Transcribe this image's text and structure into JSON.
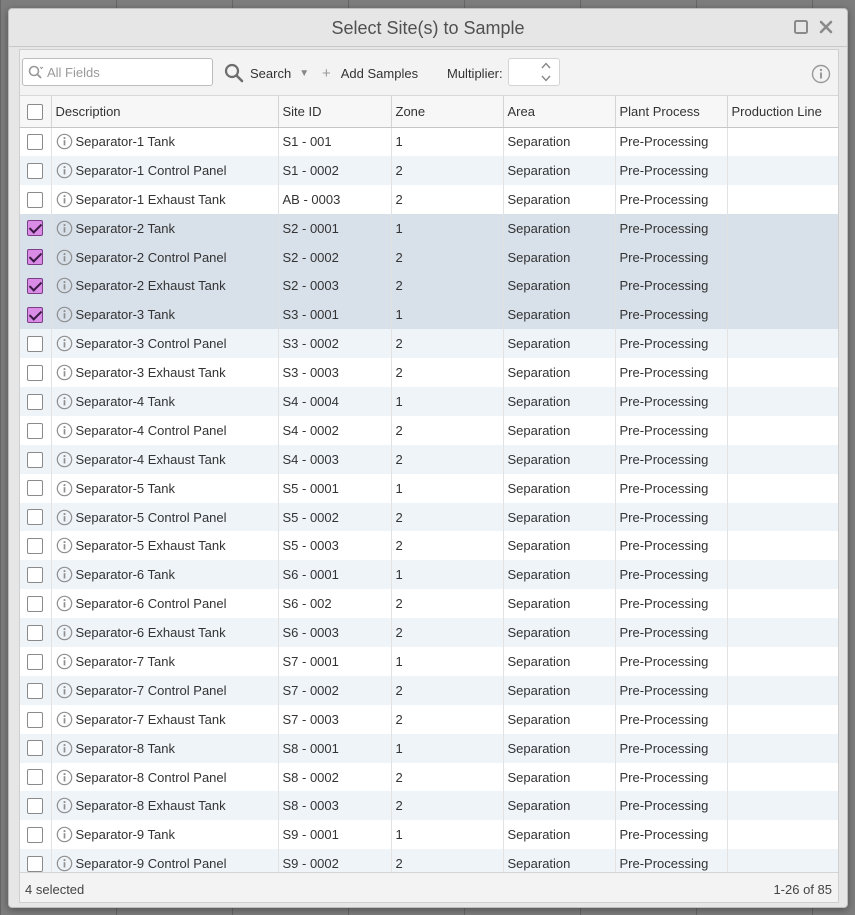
{
  "dialog": {
    "title": "Select Site(s) to Sample"
  },
  "toolbar": {
    "search_placeholder": "All Fields",
    "search_value": "",
    "search_label": "Search",
    "add_label": "Add Samples",
    "multiplier_label": "Multiplier:",
    "multiplier_value": ""
  },
  "table": {
    "columns": [
      "Description",
      "Site ID",
      "Zone",
      "Area",
      "Plant Process",
      "Production Line"
    ],
    "rows": [
      {
        "checked": false,
        "description": "Separator-1 Tank",
        "site_id": "S1 - 001",
        "zone": "1",
        "area": "Separation",
        "process": "Pre-Processing",
        "line": ""
      },
      {
        "checked": false,
        "description": "Separator-1 Control Panel",
        "site_id": "S1 - 0002",
        "zone": "2",
        "area": "Separation",
        "process": "Pre-Processing",
        "line": ""
      },
      {
        "checked": false,
        "description": "Separator-1 Exhaust Tank",
        "site_id": "AB - 0003",
        "zone": "2",
        "area": "Separation",
        "process": "Pre-Processing",
        "line": ""
      },
      {
        "checked": true,
        "description": "Separator-2 Tank",
        "site_id": "S2 - 0001",
        "zone": "1",
        "area": "Separation",
        "process": "Pre-Processing",
        "line": ""
      },
      {
        "checked": true,
        "description": "Separator-2 Control Panel",
        "site_id": "S2 - 0002",
        "zone": "2",
        "area": "Separation",
        "process": "Pre-Processing",
        "line": ""
      },
      {
        "checked": true,
        "description": "Separator-2 Exhaust Tank",
        "site_id": "S2 - 0003",
        "zone": "2",
        "area": "Separation",
        "process": "Pre-Processing",
        "line": ""
      },
      {
        "checked": true,
        "description": "Separator-3 Tank",
        "site_id": "S3 - 0001",
        "zone": "1",
        "area": "Separation",
        "process": "Pre-Processing",
        "line": ""
      },
      {
        "checked": false,
        "description": "Separator-3 Control Panel",
        "site_id": "S3 - 0002",
        "zone": "2",
        "area": "Separation",
        "process": "Pre-Processing",
        "line": ""
      },
      {
        "checked": false,
        "description": "Separator-3 Exhaust Tank",
        "site_id": "S3 - 0003",
        "zone": "2",
        "area": "Separation",
        "process": "Pre-Processing",
        "line": ""
      },
      {
        "checked": false,
        "description": "Separator-4 Tank",
        "site_id": "S4 - 0004",
        "zone": "1",
        "area": "Separation",
        "process": "Pre-Processing",
        "line": ""
      },
      {
        "checked": false,
        "description": "Separator-4 Control Panel",
        "site_id": "S4 - 0002",
        "zone": "2",
        "area": "Separation",
        "process": "Pre-Processing",
        "line": ""
      },
      {
        "checked": false,
        "description": "Separator-4 Exhaust Tank",
        "site_id": "S4 - 0003",
        "zone": "2",
        "area": "Separation",
        "process": "Pre-Processing",
        "line": ""
      },
      {
        "checked": false,
        "description": "Separator-5 Tank",
        "site_id": "S5 - 0001",
        "zone": "1",
        "area": "Separation",
        "process": "Pre-Processing",
        "line": ""
      },
      {
        "checked": false,
        "description": "Separator-5 Control Panel",
        "site_id": "S5 - 0002",
        "zone": "2",
        "area": "Separation",
        "process": "Pre-Processing",
        "line": ""
      },
      {
        "checked": false,
        "description": "Separator-5 Exhaust Tank",
        "site_id": "S5 - 0003",
        "zone": "2",
        "area": "Separation",
        "process": "Pre-Processing",
        "line": ""
      },
      {
        "checked": false,
        "description": "Separator-6 Tank",
        "site_id": "S6 - 0001",
        "zone": "1",
        "area": "Separation",
        "process": "Pre-Processing",
        "line": ""
      },
      {
        "checked": false,
        "description": "Separator-6 Control Panel",
        "site_id": "S6 - 002",
        "zone": "2",
        "area": "Separation",
        "process": "Pre-Processing",
        "line": ""
      },
      {
        "checked": false,
        "description": "Separator-6 Exhaust Tank",
        "site_id": "S6 - 0003",
        "zone": "2",
        "area": "Separation",
        "process": "Pre-Processing",
        "line": ""
      },
      {
        "checked": false,
        "description": "Separator-7 Tank",
        "site_id": "S7 - 0001",
        "zone": "1",
        "area": "Separation",
        "process": "Pre-Processing",
        "line": ""
      },
      {
        "checked": false,
        "description": "Separator-7 Control Panel",
        "site_id": "S7 - 0002",
        "zone": "2",
        "area": "Separation",
        "process": "Pre-Processing",
        "line": ""
      },
      {
        "checked": false,
        "description": "Separator-7 Exhaust Tank",
        "site_id": "S7 - 0003",
        "zone": "2",
        "area": "Separation",
        "process": "Pre-Processing",
        "line": ""
      },
      {
        "checked": false,
        "description": "Separator-8 Tank",
        "site_id": "S8 - 0001",
        "zone": "1",
        "area": "Separation",
        "process": "Pre-Processing",
        "line": ""
      },
      {
        "checked": false,
        "description": "Separator-8 Control Panel",
        "site_id": "S8 - 0002",
        "zone": "2",
        "area": "Separation",
        "process": "Pre-Processing",
        "line": ""
      },
      {
        "checked": false,
        "description": "Separator-8 Exhaust Tank",
        "site_id": "S8 - 0003",
        "zone": "2",
        "area": "Separation",
        "process": "Pre-Processing",
        "line": ""
      },
      {
        "checked": false,
        "description": "Separator-9 Tank",
        "site_id": "S9 - 0001",
        "zone": "1",
        "area": "Separation",
        "process": "Pre-Processing",
        "line": ""
      },
      {
        "checked": false,
        "description": "Separator-9 Control Panel",
        "site_id": "S9 - 0002",
        "zone": "2",
        "area": "Separation",
        "process": "Pre-Processing",
        "line": ""
      }
    ]
  },
  "footer": {
    "selected_text": "4 selected",
    "page_range": "1-26 of 85"
  },
  "colors": {
    "checked_fill": "#d98be6",
    "selected_row": "#d8e0ea",
    "alt_row": "#eff4f9"
  },
  "icons": [
    "maximize-icon",
    "close-icon",
    "search-icon",
    "chevron-down-icon",
    "plus-icon",
    "info-icon",
    "spinner-up-icon",
    "spinner-down-icon"
  ]
}
